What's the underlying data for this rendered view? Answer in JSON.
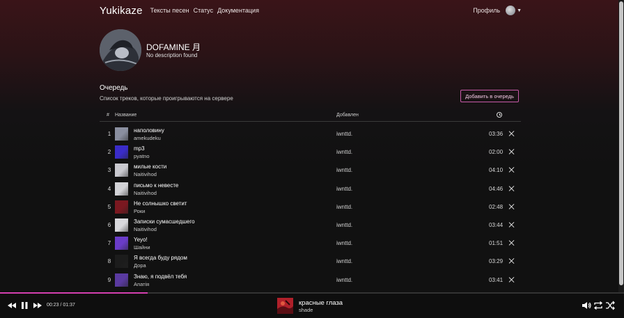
{
  "nav": {
    "brand": "Yukikaze",
    "links": [
      "Тексты песен",
      "Статус",
      "Документация"
    ],
    "profile": "Профиль"
  },
  "channel": {
    "title": "DOFAMINE 月",
    "description": "No description found"
  },
  "queue": {
    "title": "Очередь",
    "subtitle": "Список треков, которые проигрываются на сервере",
    "add_button": "Добавить в очередь",
    "columns": {
      "num": "#",
      "name": "Название",
      "added": "Добавлен"
    },
    "tracks": [
      {
        "num": "1",
        "name": "наполовину",
        "artist": "amekudeku",
        "added": "iwnttd.",
        "duration": "03:36",
        "color": "#8a8fa0"
      },
      {
        "num": "2",
        "name": "mp3",
        "artist": "pyatno",
        "added": "iwnttd.",
        "duration": "02:00",
        "color": "#3a2cc8"
      },
      {
        "num": "3",
        "name": "милые кости",
        "artist": "Naitivihod",
        "added": "iwnttd.",
        "duration": "04:10",
        "color": "#c9c9cf"
      },
      {
        "num": "4",
        "name": "письмо к невесте",
        "artist": "Naitivihod",
        "added": "iwnttd.",
        "duration": "04:46",
        "color": "#d2d2d6"
      },
      {
        "num": "5",
        "name": "Не солнышко светит",
        "artist": "Роки",
        "added": "iwnttd.",
        "duration": "02:48",
        "color": "#7a1820"
      },
      {
        "num": "6",
        "name": "Записки сумасшедшего",
        "artist": "Naitivihod",
        "added": "iwnttd.",
        "duration": "03:44",
        "color": "#d8d8dc"
      },
      {
        "num": "7",
        "name": "Yeyo!",
        "artist": "Шайни",
        "added": "iwnttd.",
        "duration": "01:51",
        "color": "#6a3cc8"
      },
      {
        "num": "8",
        "name": "Я всегда буду рядом",
        "artist": "Дора",
        "added": "iwnttd.",
        "duration": "03:29",
        "color": "#1c1c1c"
      },
      {
        "num": "9",
        "name": "Знаю, я подвёл тебя",
        "artist": "Апатія",
        "added": "iwnttd.",
        "duration": "03:41",
        "color": "#5a3aa0"
      }
    ]
  },
  "player": {
    "time": "00:23 / 01:37",
    "progress_fraction": 0.2371,
    "title": "красные глаза",
    "artist": "shade",
    "accent": "#d43fb0",
    "cover_color": "#b0202a"
  }
}
